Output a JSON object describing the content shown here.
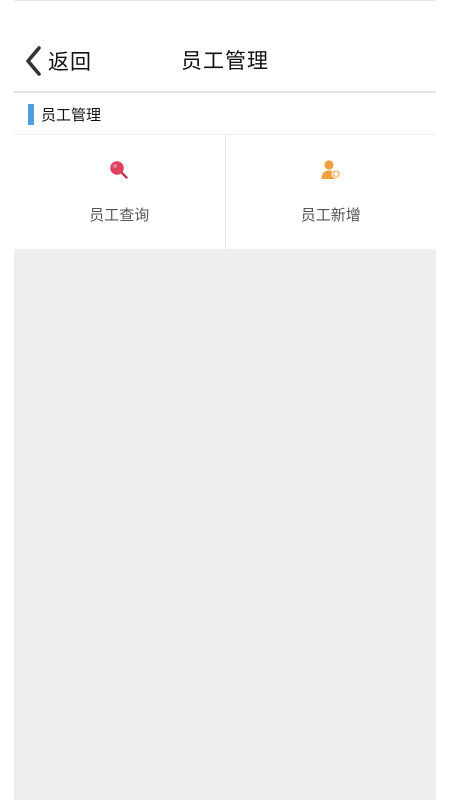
{
  "navbar": {
    "back_label": "返回",
    "title": "员工管理"
  },
  "section": {
    "title": "员工管理",
    "accent_color": "#4d9fe0"
  },
  "menu": {
    "items": [
      {
        "label": "员工查询",
        "icon": "search-icon",
        "icon_color": "#e0415f"
      },
      {
        "label": "员工新增",
        "icon": "add-user-icon",
        "icon_color": "#f0a040"
      }
    ]
  }
}
